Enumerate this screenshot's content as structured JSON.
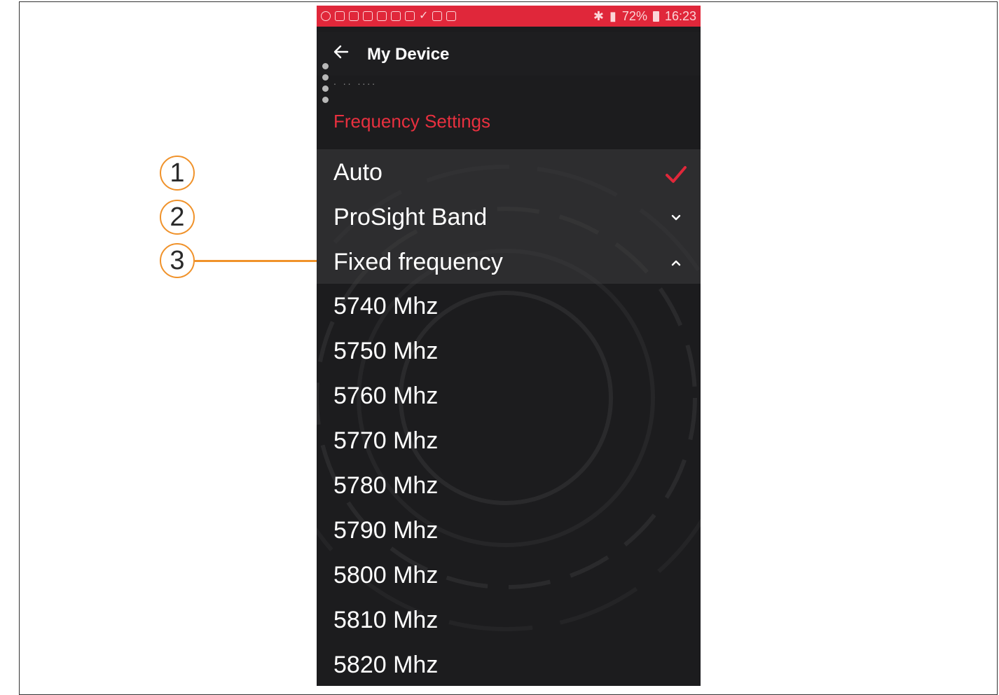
{
  "status_bar": {
    "battery": "72%",
    "time": "16:23"
  },
  "app_bar": {
    "back_icon": "arrow-left-icon",
    "title": "My Device"
  },
  "faint_row_text": ". .. ....",
  "section": {
    "title": "Frequency Settings"
  },
  "options": [
    {
      "label": "Auto",
      "indicator": "checkmark-icon",
      "selected": true
    },
    {
      "label": "ProSight Band",
      "indicator": "chevron-down-icon",
      "selected": false
    },
    {
      "label": "Fixed frequency",
      "indicator": "chevron-up-icon",
      "selected": false
    }
  ],
  "frequencies": [
    "5740 Mhz",
    "5750 Mhz",
    "5760 Mhz",
    "5770 Mhz",
    "5780 Mhz",
    "5790 Mhz",
    "5800 Mhz",
    "5810 Mhz",
    "5820 Mhz"
  ],
  "callouts": [
    "1",
    "2",
    "3"
  ],
  "colors": {
    "accent_red": "#e0273a",
    "callout_orange": "#f0922a",
    "background_dark": "#1c1c1e"
  }
}
